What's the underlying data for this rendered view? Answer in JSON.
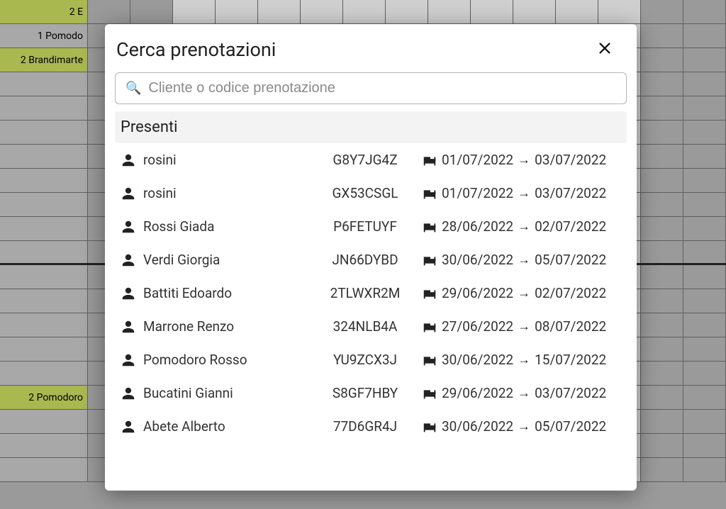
{
  "background": {
    "rooms": [
      {
        "label": "2 E",
        "olive": true
      },
      {
        "label": "1 Pomodo",
        "olive": false
      },
      {
        "label": "2 Brandimarte",
        "olive": true
      },
      {
        "label": "",
        "olive": false
      },
      {
        "label": "",
        "olive": false
      },
      {
        "label": "",
        "olive": false
      },
      {
        "label": "",
        "olive": false
      },
      {
        "label": "",
        "olive": false
      },
      {
        "label": "",
        "olive": false
      },
      {
        "label": "",
        "olive": false
      },
      {
        "label": "",
        "olive": false
      },
      {
        "label": "",
        "olive": false
      },
      {
        "label": "",
        "olive": false
      },
      {
        "label": "",
        "olive": false
      },
      {
        "label": "",
        "olive": false
      },
      {
        "label": "",
        "olive": false
      },
      {
        "label": "2 Pomodoro",
        "olive": true
      },
      {
        "label": "",
        "olive": false
      },
      {
        "label": "",
        "olive": false
      },
      {
        "label": "",
        "olive": false
      }
    ]
  },
  "modal": {
    "title": "Cerca prenotazioni",
    "search_placeholder": "Cliente o codice prenotazione",
    "section_label": "Presenti",
    "bookings": [
      {
        "name": "rosini",
        "code": "G8Y7JG4Z",
        "from": "01/07/2022",
        "to": "03/07/2022"
      },
      {
        "name": "rosini",
        "code": "GX53CSGL",
        "from": "01/07/2022",
        "to": "03/07/2022"
      },
      {
        "name": "Rossi Giada",
        "code": "P6FETUYF",
        "from": "28/06/2022",
        "to": "02/07/2022"
      },
      {
        "name": "Verdi Giorgia",
        "code": "JN66DYBD",
        "from": "30/06/2022",
        "to": "05/07/2022"
      },
      {
        "name": "Battiti Edoardo",
        "code": "2TLWXR2M",
        "from": "29/06/2022",
        "to": "02/07/2022"
      },
      {
        "name": "Marrone Renzo",
        "code": "324NLB4A",
        "from": "27/06/2022",
        "to": "08/07/2022"
      },
      {
        "name": "Pomodoro Rosso",
        "code": "YU9ZCX3J",
        "from": "30/06/2022",
        "to": "15/07/2022"
      },
      {
        "name": "Bucatini Gianni",
        "code": "S8GF7HBY",
        "from": "29/06/2022",
        "to": "03/07/2022"
      },
      {
        "name": "Abete Alberto",
        "code": "77D6GR4J",
        "from": "30/06/2022",
        "to": "05/07/2022"
      }
    ]
  }
}
